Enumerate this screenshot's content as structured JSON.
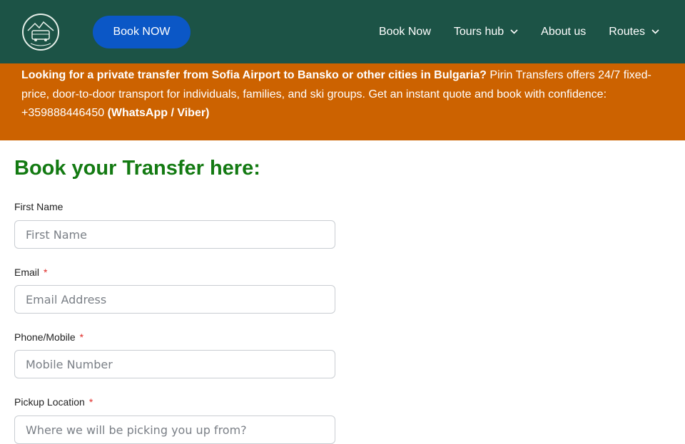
{
  "header": {
    "logo_name": "Pirin Transfers logo",
    "book_button": "Book NOW",
    "nav": [
      {
        "label": "Book Now",
        "has_dropdown": false
      },
      {
        "label": "Tours hub",
        "has_dropdown": true
      },
      {
        "label": "About us",
        "has_dropdown": false
      },
      {
        "label": "Routes",
        "has_dropdown": true
      }
    ]
  },
  "banner": {
    "bold_lead": "Looking for a private transfer from Sofia Airport to Bansko or other cities in Bulgaria?",
    "body": " Pirin Transfers offers 24/7 fixed-price, door-to-door transport for individuals, families, and ski groups. Get an instant quote and book with confidence: +359888446450 ",
    "bold_tail": "(WhatsApp / Viber)"
  },
  "form": {
    "title": "Book your Transfer here:",
    "fields": [
      {
        "label": "First Name",
        "required": false,
        "placeholder": "First Name"
      },
      {
        "label": "Email",
        "required": true,
        "placeholder": "Email Address"
      },
      {
        "label": "Phone/Mobile",
        "required": true,
        "placeholder": "Mobile Number"
      },
      {
        "label": "Pickup Location",
        "required": true,
        "placeholder": "Where we will be picking you up from?"
      }
    ],
    "required_mark": "*"
  },
  "colors": {
    "header_bg": "#1c5346",
    "button_bg": "#0b57c6",
    "banner_bg": "#cc6200",
    "title_color": "#137a12",
    "required_color": "#e02b27"
  }
}
